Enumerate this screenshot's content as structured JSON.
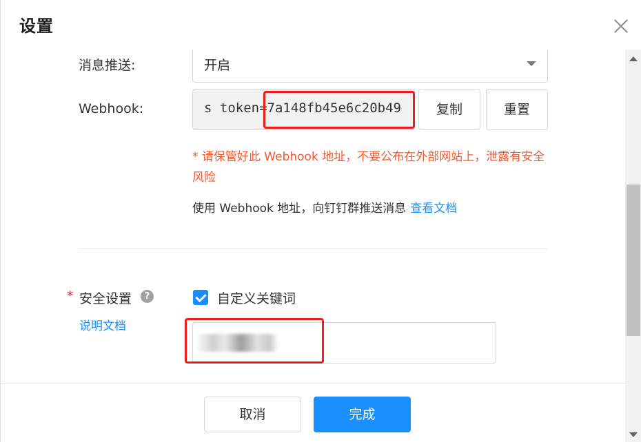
{
  "dialog": {
    "title": "设置",
    "close_icon": "close-icon"
  },
  "message_push": {
    "label": "消息推送:",
    "value": "开启"
  },
  "webhook": {
    "label": "Webhook:",
    "token_text": "s token=7a148fb45e6c20b49",
    "copy_label": "复制",
    "reset_label": "重置",
    "warning": "* 请保管好此 Webhook 地址，不要公布在外部网站上，泄露有安全风险",
    "usage_text": "使用 Webhook 地址，向钉钉群推送消息",
    "usage_link": "查看文档"
  },
  "security": {
    "required_mark": "*",
    "label": "安全设置",
    "help_icon": "?",
    "doc_link": "说明文档",
    "checkbox_label": "自定义关键词",
    "checkbox_checked": true
  },
  "footer": {
    "cancel_label": "取消",
    "done_label": "完成"
  },
  "colors": {
    "primary": "#1890ff",
    "warning": "#f05a30",
    "highlight": "#ee1c1c"
  }
}
